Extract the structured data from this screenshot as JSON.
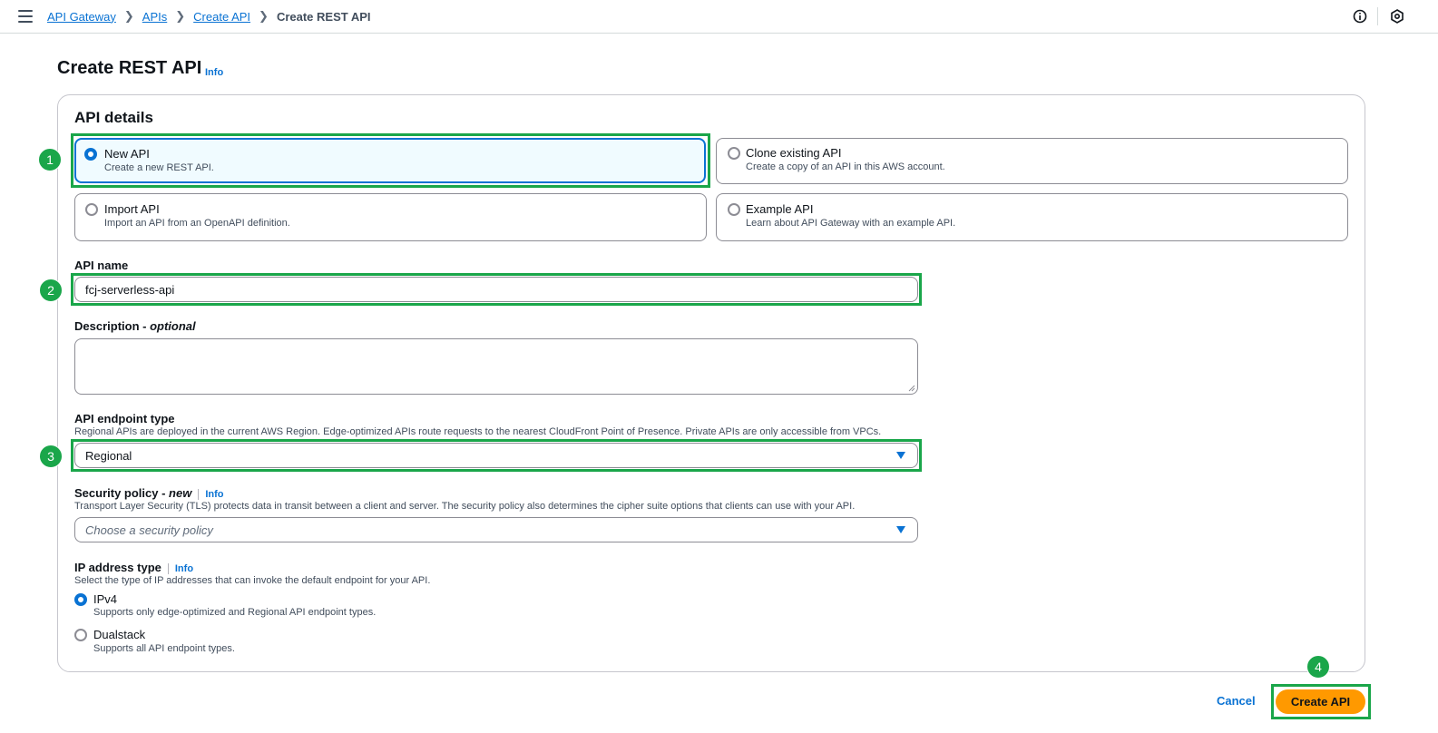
{
  "breadcrumb": {
    "items": [
      "API Gateway",
      "APIs",
      "Create API"
    ],
    "current": "Create REST API"
  },
  "page": {
    "title": "Create REST API",
    "info": "Info"
  },
  "api_details": {
    "heading": "API details",
    "options": [
      {
        "label": "New API",
        "description": "Create a new REST API.",
        "selected": true
      },
      {
        "label": "Clone existing API",
        "description": "Create a copy of an API in this AWS account.",
        "selected": false
      },
      {
        "label": "Import API",
        "description": "Import an API from an OpenAPI definition.",
        "selected": false
      },
      {
        "label": "Example API",
        "description": "Learn about API Gateway with an example API.",
        "selected": false
      }
    ]
  },
  "api_name": {
    "label": "API name",
    "value": "fcj-serverless-api"
  },
  "description": {
    "label": "Description",
    "optional": "optional",
    "value": ""
  },
  "endpoint_type": {
    "label": "API endpoint type",
    "description": "Regional APIs are deployed in the current AWS Region. Edge-optimized APIs route requests to the nearest CloudFront Point of Presence. Private APIs are only accessible from VPCs.",
    "value": "Regional"
  },
  "security_policy": {
    "label": "Security policy",
    "tag": "new",
    "info": "Info",
    "description": "Transport Layer Security (TLS) protects data in transit between a client and server. The security policy also determines the cipher suite options that clients can use with your API.",
    "placeholder": "Choose a security policy"
  },
  "ip_address_type": {
    "label": "IP address type",
    "info": "Info",
    "description": "Select the type of IP addresses that can invoke the default endpoint for your API.",
    "options": [
      {
        "label": "IPv4",
        "description": "Supports only edge-optimized and Regional API endpoint types.",
        "selected": true
      },
      {
        "label": "Dualstack",
        "description": "Supports all API endpoint types.",
        "selected": false
      }
    ]
  },
  "actions": {
    "cancel": "Cancel",
    "create": "Create API"
  },
  "step_markers": [
    "1",
    "2",
    "3",
    "4"
  ],
  "colors": {
    "accent": "#0972d3",
    "primary_button": "#ff9900",
    "step_highlight": "#1aa64a"
  },
  "icons": {
    "menu": "hamburger-icon",
    "info": "info-circle-icon",
    "settings": "hexagon-settings-icon",
    "separator": "chevron-right-icon",
    "dropdown": "caret-down-icon"
  }
}
